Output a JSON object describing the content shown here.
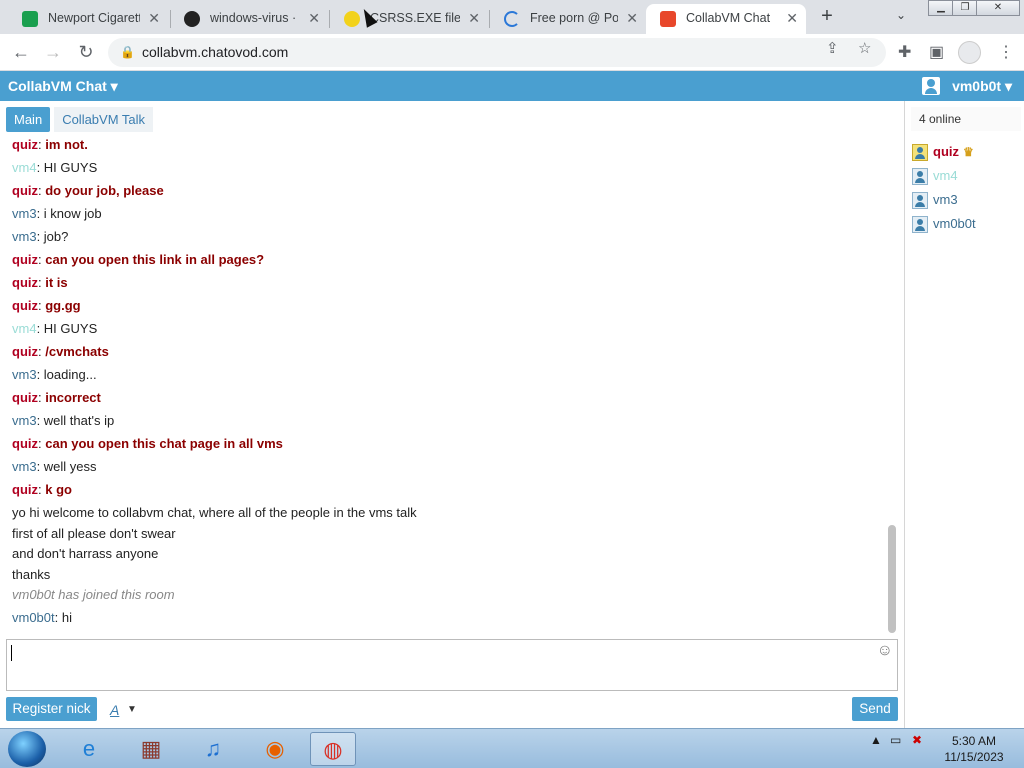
{
  "browser": {
    "tabs": [
      {
        "title": "Newport Cigarettes",
        "favicon_color": "#1a9f4f"
      },
      {
        "title": "windows-virus · G",
        "favicon_color": "#222222"
      },
      {
        "title": "CSRSS.EXE file tro",
        "favicon_color": "#f2d21b"
      },
      {
        "title": "Free porn @ Porn",
        "favicon_color": "#2b78d8"
      },
      {
        "title": "CollabVM Chat",
        "favicon_color": "#e8472b"
      }
    ],
    "url": "collabvm.chatovod.com"
  },
  "app": {
    "brand": "CollabVM Chat ▾",
    "current_user": "vm0b0t ▾",
    "colors": {
      "accent": "#4a9fd0",
      "quiz": "#b00020",
      "vm4": "#9adcd6",
      "vm3": "#3b6d8f"
    }
  },
  "rooms": {
    "main": "Main",
    "other": "CollabVM Talk"
  },
  "messages": [
    {
      "nick": "quiz",
      "text": "im not."
    },
    {
      "nick": "vm4",
      "text": "HI GUYS"
    },
    {
      "nick": "quiz",
      "text": "do your job, please"
    },
    {
      "nick": "vm3",
      "text": "i know job"
    },
    {
      "nick": "vm3",
      "text": "job?"
    },
    {
      "nick": "quiz",
      "text": "can you open this link in all pages?"
    },
    {
      "nick": "quiz",
      "text": "it is"
    },
    {
      "nick": "quiz",
      "text": "gg.gg"
    },
    {
      "nick": "vm4",
      "text": "HI GUYS"
    },
    {
      "nick": "quiz",
      "text": "/cvmchats"
    },
    {
      "nick": "vm3",
      "text": "loading..."
    },
    {
      "nick": "quiz",
      "text": "incorrect"
    },
    {
      "nick": "vm3",
      "text": "well that's ip"
    },
    {
      "nick": "quiz",
      "text": "can you open this chat page in all vms"
    },
    {
      "nick": "vm3",
      "text": "well yess"
    },
    {
      "nick": "quiz",
      "text": "k go"
    }
  ],
  "notice": [
    "yo hi welcome to collabvm chat, where all of the people in the vms talk",
    "first of all please don't swear",
    "and don't harrass anyone",
    "thanks"
  ],
  "system_message": "vm0b0t has joined this room",
  "last_message": {
    "nick": "vm0b0t",
    "text": "hi"
  },
  "sidebar": {
    "online_count": "4 online",
    "users": [
      "quiz",
      "vm4",
      "vm3",
      "vm0b0t"
    ]
  },
  "composer": {
    "register_label": "Register nick",
    "font_label": "A",
    "send_label": "Send"
  },
  "taskbar": {
    "time": "5:30 AM",
    "date": "11/15/2023"
  }
}
